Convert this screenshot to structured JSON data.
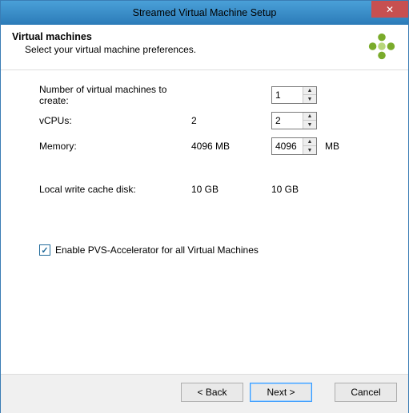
{
  "titlebar": {
    "title": "Streamed Virtual Machine Setup",
    "close": "✕"
  },
  "header": {
    "heading": "Virtual machines",
    "sub": "Select your virtual machine preferences."
  },
  "rows": {
    "count": {
      "label": "Number of virtual machines to create:",
      "static": "",
      "value": "1",
      "suffix": ""
    },
    "vcpus": {
      "label": "vCPUs:",
      "static": "2",
      "value": "2",
      "suffix": ""
    },
    "memory": {
      "label": "Memory:",
      "static": "4096 MB",
      "value": "4096",
      "suffix": "MB"
    },
    "cache": {
      "label": "Local write cache disk:",
      "static": "10 GB",
      "value": "10 GB",
      "suffix": ""
    }
  },
  "checkbox": {
    "label": "Enable PVS-Accelerator for all Virtual Machines",
    "checked": "✓"
  },
  "buttons": {
    "back": "< Back",
    "next": "Next >",
    "cancel": "Cancel"
  }
}
